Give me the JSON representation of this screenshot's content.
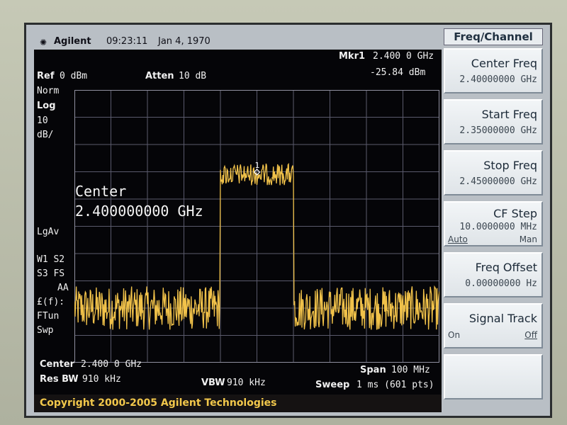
{
  "header": {
    "brand": "Agilent",
    "time": "09:23:11",
    "date": "Jan 4, 1970"
  },
  "status_left": {
    "ref_label": "Ref",
    "ref_value": "0 dBm",
    "atten_label": "Atten",
    "atten_value": "10 dB",
    "norm": "Norm",
    "log": "Log",
    "scale_value": "10",
    "scale_unit": "dB/",
    "lgav": "LgAv",
    "w1s2": "W1  S2",
    "s3fs": "S3  FS",
    "aa": "AA",
    "ff": "£(f):",
    "ftun": "FTun",
    "swp": "Swp"
  },
  "marker": {
    "label": "Mkr1",
    "freq": "2.400 0 GHz",
    "level": "-25.84 dBm",
    "number": "1"
  },
  "annotation": {
    "center_title": "Center",
    "center_value": "2.400000000 GHz"
  },
  "footer": {
    "center_label": "Center",
    "center_value": "2.400 0 GHz",
    "span_label": "Span",
    "span_value": "100 MHz",
    "resbw_label": "Res BW",
    "resbw_value": "910 kHz",
    "vbw_label": "VBW",
    "vbw_value": "910 kHz",
    "sweep_label": "Sweep",
    "sweep_value": "1 ms (601 pts)"
  },
  "copyright": "Copyright 2000-2005 Agilent Technologies",
  "softkeys": {
    "menu_title": "Freq/Channel",
    "center_freq": {
      "label": "Center Freq",
      "value": "2.40000000 GHz"
    },
    "start_freq": {
      "label": "Start Freq",
      "value": "2.35000000 GHz"
    },
    "stop_freq": {
      "label": "Stop Freq",
      "value": "2.45000000 GHz"
    },
    "cf_step": {
      "label": "CF Step",
      "value": "10.0000000 MHz",
      "opt_auto": "Auto",
      "opt_man": "Man"
    },
    "freq_offset": {
      "label": "Freq Offset",
      "value": "0.00000000 Hz"
    },
    "signal_track": {
      "label": "Signal Track",
      "opt_on": "On",
      "opt_off": "Off"
    }
  },
  "trace": {
    "color": "#f1c24a",
    "noise_floor_dbm": -80,
    "noise_spread_db": 8,
    "signal_top_dbm": -27,
    "signal_spread_db": 4,
    "signal_start_mhz": 2390,
    "signal_end_mhz": 2410
  }
}
